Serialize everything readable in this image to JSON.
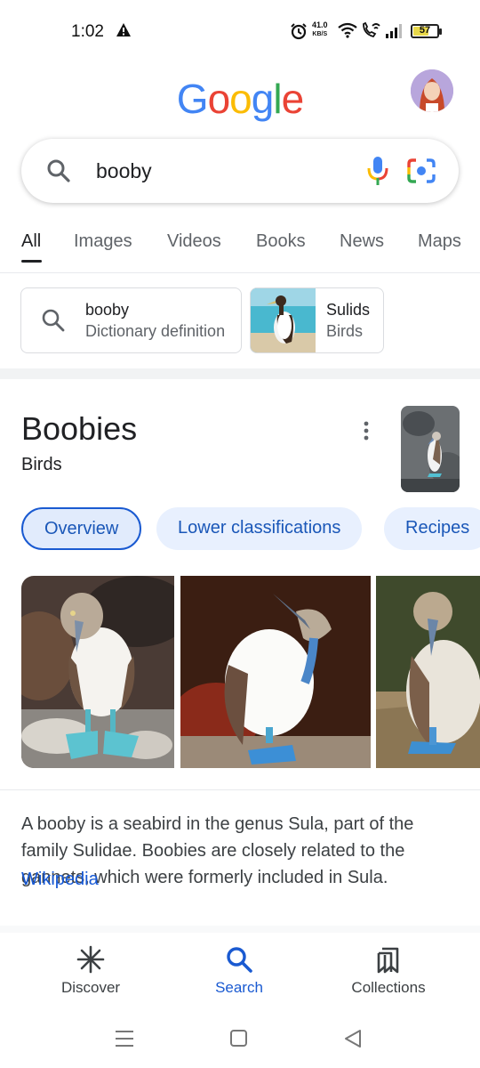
{
  "status_bar": {
    "time": "1:02",
    "net_speed_value": "41.0",
    "net_speed_unit": "KB/S",
    "battery": "57"
  },
  "header": {
    "logo_letters": [
      "G",
      "o",
      "o",
      "g",
      "l",
      "e"
    ],
    "logo_colors": [
      "#4285F4",
      "#EA4335",
      "#FBBC05",
      "#4285F4",
      "#34A853",
      "#EA4335"
    ]
  },
  "search": {
    "query": "booby"
  },
  "tabs": [
    {
      "label": "All",
      "active": true
    },
    {
      "label": "Images",
      "active": false
    },
    {
      "label": "Videos",
      "active": false
    },
    {
      "label": "Books",
      "active": false
    },
    {
      "label": "News",
      "active": false
    },
    {
      "label": "Maps",
      "active": false
    }
  ],
  "suggestions": [
    {
      "title": "booby",
      "subtitle": "Dictionary definition",
      "icon": "search-icon"
    },
    {
      "title": "Sulids",
      "subtitle": "Birds",
      "icon": "bird-thumbnail"
    }
  ],
  "knowledge_panel": {
    "title": "Boobies",
    "subtitle": "Birds",
    "chips": [
      {
        "label": "Overview",
        "active": true
      },
      {
        "label": "Lower classifications",
        "active": false
      },
      {
        "label": "Recipes",
        "active": false
      }
    ],
    "description": "A booby is a seabird in the genus Sula, part of the family Sulidae. Boobies are closely related to the gannets, which were formerly included in Sula.",
    "source_link": "Wikipedia"
  },
  "bottom_nav": [
    {
      "label": "Discover",
      "icon": "asterisk-icon",
      "active": false
    },
    {
      "label": "Search",
      "icon": "search-icon",
      "active": true
    },
    {
      "label": "Collections",
      "icon": "collections-icon",
      "active": false
    }
  ],
  "colors": {
    "accent_blue": "#1a5ad1",
    "chip_bg": "#e8f0fe",
    "link_blue": "#1558d6",
    "booby_feet": "#3db7c9"
  }
}
